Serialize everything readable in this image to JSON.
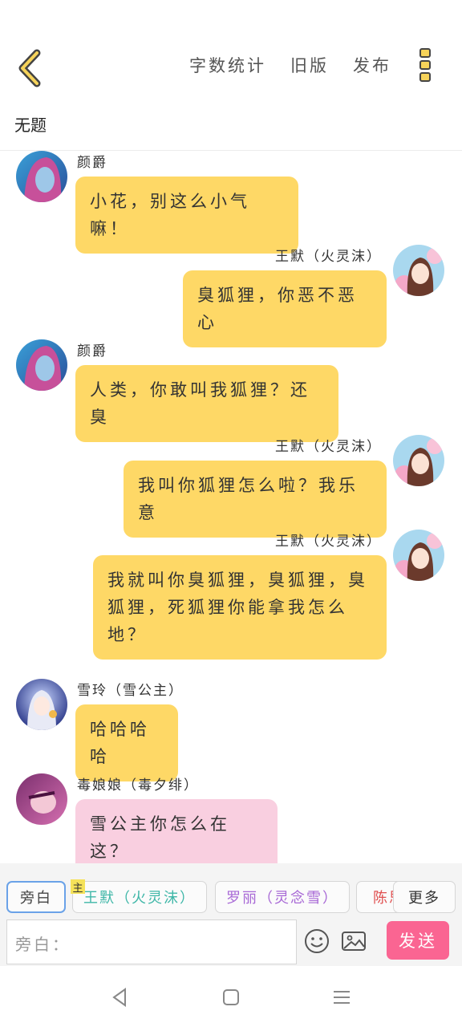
{
  "header": {
    "actions": [
      "字数统计",
      "旧版",
      "发布"
    ],
    "doc_title": "无题"
  },
  "messages": [
    {
      "speaker": "颜爵",
      "text": "小花，别这么小气嘛！",
      "side": "left",
      "color": "yellow"
    },
    {
      "speaker": "王默（火灵沫）",
      "text": "臭狐狸，你恶不恶心",
      "side": "right",
      "color": "yellow"
    },
    {
      "speaker": "颜爵",
      "text": "人类，你敢叫我狐狸？还臭",
      "side": "left",
      "color": "yellow"
    },
    {
      "speaker": "王默（火灵沫）",
      "text": "我叫你狐狸怎么啦？我乐意",
      "side": "right",
      "color": "yellow"
    },
    {
      "speaker": "王默（火灵沫）",
      "text": "我就叫你臭狐狸，臭狐狸，臭狐狸，死狐狸你能拿我怎么地？",
      "side": "right",
      "color": "yellow"
    },
    {
      "speaker": "雪玲（雪公主）",
      "text": "哈哈哈哈",
      "side": "left",
      "color": "yellow"
    },
    {
      "speaker": "毒娘娘（毒夕绯）",
      "text": "雪公主你怎么在这？",
      "side": "left",
      "color": "pink"
    }
  ],
  "roles": {
    "narrator": "旁白",
    "main_badge": "主",
    "items": [
      {
        "label": "王默（火灵沫）",
        "color": "#3fb7a8"
      },
      {
        "label": "罗丽（灵念雪）",
        "color": "#a869d6"
      },
      {
        "label": "陈思",
        "color": "#e05050"
      }
    ],
    "more": "更多"
  },
  "composer": {
    "placeholder": "旁白：",
    "send_label": "发送",
    "emoji_icon": "emoji-icon",
    "image_icon": "image-icon"
  },
  "colors": {
    "bubble_yellow": "#fed866",
    "bubble_pink": "#f9cfe0",
    "send": "#fa6592",
    "accent": "#f6d35a"
  }
}
